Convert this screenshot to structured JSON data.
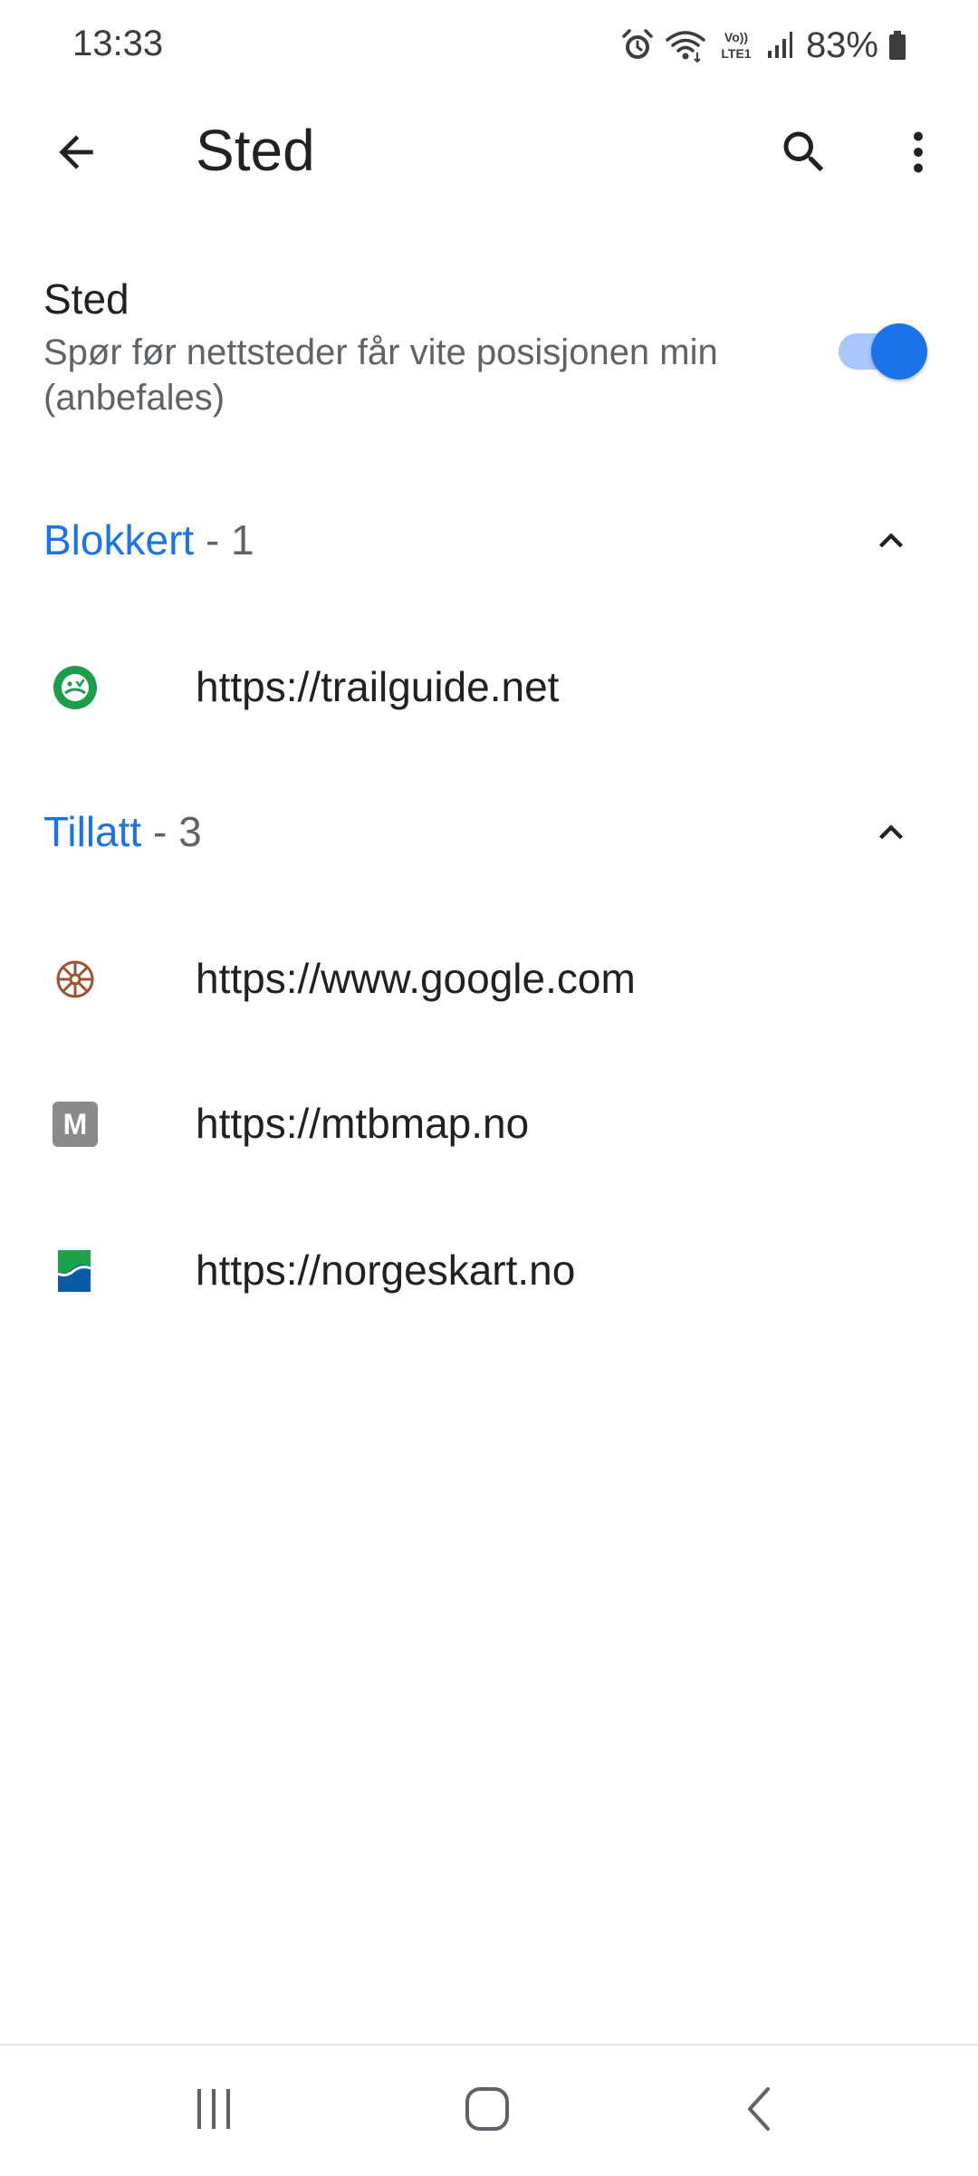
{
  "status_bar": {
    "time": "13:33",
    "battery_percent": "83%",
    "icons": [
      "alarm-icon",
      "wifi-icon",
      "volte-icon",
      "signal-icon",
      "battery-icon"
    ],
    "volte_text_top": "Vo))",
    "volte_text_bottom": "LTE1"
  },
  "app_bar": {
    "title": "Sted",
    "back_icon": "arrow-back-icon",
    "search_icon": "search-icon",
    "more_icon": "more-vert-icon"
  },
  "location_setting": {
    "title": "Sted",
    "summary": "Spør før nettsteder får vite posisjonen min (anbefales)",
    "toggle_on": true
  },
  "sections": {
    "blocked": {
      "name": "Blokkert",
      "count": " - 1",
      "expanded": true,
      "sites": [
        {
          "url": "https://trailguide.net",
          "icon": "trailguide-favicon"
        }
      ]
    },
    "allowed": {
      "name": "Tillatt",
      "count": " - 3",
      "expanded": true,
      "sites": [
        {
          "url": "https://www.google.com",
          "icon": "google-favicon"
        },
        {
          "url": "https://mtbmap.no",
          "icon": "mtbmap-favicon",
          "letter": "M"
        },
        {
          "url": "https://norgeskart.no",
          "icon": "norgeskart-favicon"
        }
      ]
    }
  },
  "nav_bar": {
    "buttons": [
      "recents-icon",
      "home-icon",
      "back-icon"
    ]
  },
  "colors": {
    "accent": "#1a73e8",
    "toggle_track": "#a8c7fa",
    "secondary_text": "#5f6368",
    "primary_text": "#202124"
  }
}
